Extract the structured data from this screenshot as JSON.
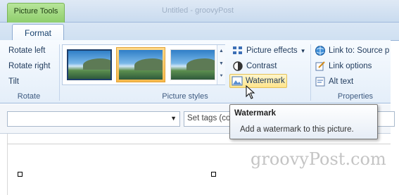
{
  "context_tab": {
    "label": "Picture Tools"
  },
  "title_faint": "Untitled - groovyPost",
  "tabs": [
    {
      "label": "Format"
    }
  ],
  "groups": {
    "rotate": {
      "label": "Rotate",
      "items": [
        {
          "label": "Rotate left"
        },
        {
          "label": "Rotate right"
        },
        {
          "label": "Tilt"
        }
      ]
    },
    "picture_styles": {
      "label": "Picture styles",
      "thumbnails": [
        {
          "state": "default"
        },
        {
          "state": "selected"
        },
        {
          "state": "plain"
        }
      ],
      "buttons": {
        "effects": "Picture effects",
        "contrast": "Contrast",
        "watermark": "Watermark"
      }
    },
    "properties": {
      "label": "Properties",
      "items": [
        {
          "label": "Link to: Source p"
        },
        {
          "label": "Link options"
        },
        {
          "label": "Alt text"
        }
      ]
    }
  },
  "document": {
    "tags_placeholder": "Set tags (co"
  },
  "tooltip": {
    "title": "Watermark",
    "body": "Add a watermark to this picture."
  },
  "brand": "groovyPost.com",
  "colors": {
    "context_tab": "#9cd67a",
    "ribbon": "#e4eef9",
    "hover_button": "#ffe58c",
    "tooltip_border": "#767676"
  }
}
